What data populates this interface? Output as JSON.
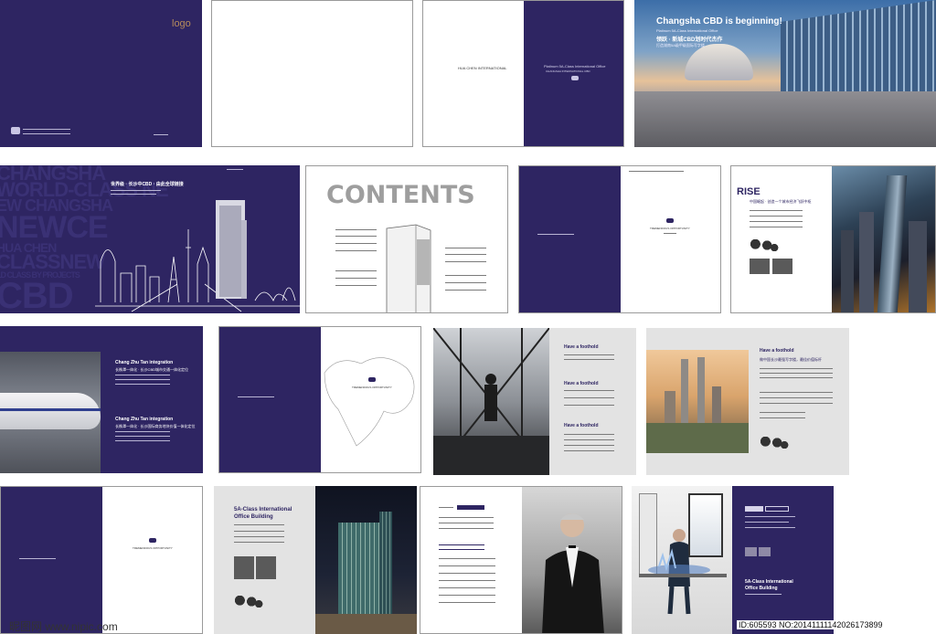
{
  "covers": {
    "logo": "logo",
    "changsha_title": "Changsha CBD is beginning!",
    "changsha_sub": "Platinum 5A-Class International Office",
    "changsha_cn_title": "领跃 · 新城CBD划时代杰作",
    "changsha_cn_sub": "打造湖南5A级甲级国际写字楼",
    "hua_chen": "HUA CHEN INTERNATIONAL",
    "platinum": "Platinum 5A-Class International Office",
    "platinum_sub": "CHANGSHA INTERNATIONAL CBD"
  },
  "world_class": {
    "bg_words": [
      "CHANGSHA",
      "WORLD-CLASS NE",
      "EW CHANGSHA",
      "NEWCE",
      "HUA CHEN",
      "CLASSNEW",
      "LD CLASS BY PROJECTS",
      "CBD"
    ],
    "headline": "世界级 · 长沙中CBD · 由此全球链接"
  },
  "contents": {
    "title": "CONTENTS"
  },
  "rise": {
    "title": "RISE",
    "cn": "中国崛起 · 创造一个城市经济飞跃中枢"
  },
  "train": {
    "title1": "Chang Zhu Tan integration",
    "cn1": "长株潭一体化 · 长沙CBD城市交通一体化定位",
    "title2": "Chang Zhu Tan integration",
    "cn2": "长株潭一体化 · 长沙国际商务地块价值一体化定位"
  },
  "foothold": {
    "t1": "Have a foothold",
    "t2": "Have a foothold",
    "t3": "Have a foothold",
    "t4": "Have a foothold",
    "cn4": "做中国长沙最强写字楼，最佳价值标杆"
  },
  "fiveA": {
    "title_l1": "5A-Class International",
    "title_l2": "Office Building",
    "right_l1": "5A-Class International",
    "right_l2": "Office Building"
  },
  "opportunity": "TREMENDOUS OPPORTUNITY",
  "watermark": {
    "site": "昵图网 www.nipic.com",
    "id": "ID:605593 NO:20141111142026173899"
  }
}
